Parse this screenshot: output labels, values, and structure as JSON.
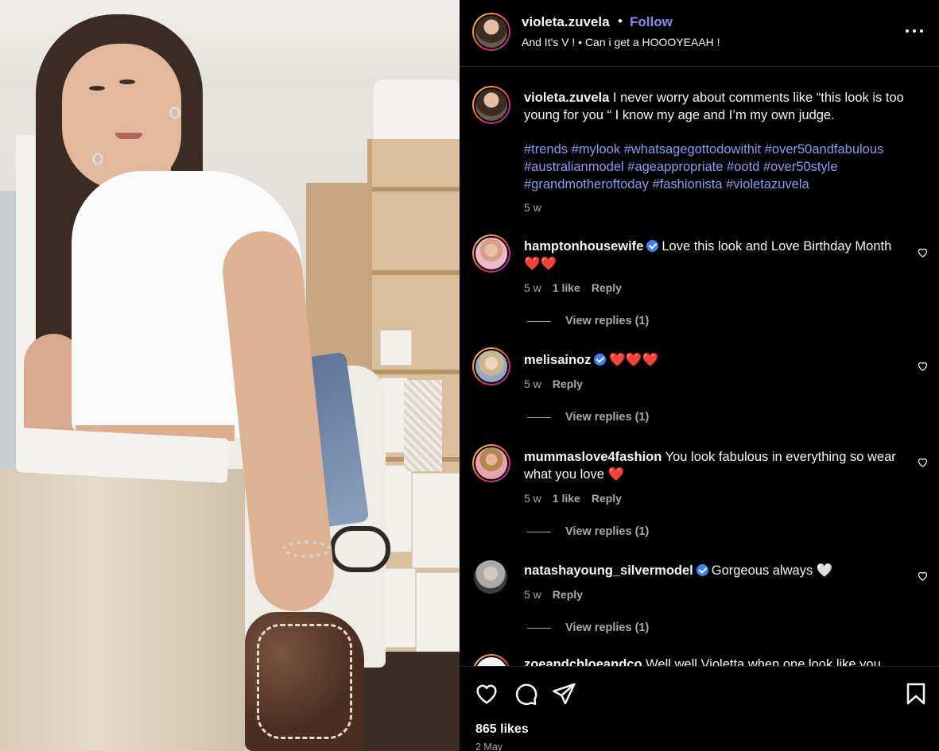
{
  "post": {
    "username": "violeta.zuvela",
    "follow_label": "Follow",
    "subtitle": "And It's V ! • Can i get a HOOOYEAAH !",
    "caption_username": "violeta.zuvela",
    "caption_text": "I never worry about comments like “this look is too young for you “ I know my age and I’m my own judge.",
    "hashtags": [
      "#trends",
      "#mylook",
      "#whatsagegottodowithit",
      "#over50andfabulous",
      "#australianmodel",
      "#ageappropriate",
      "#ootd",
      "#over50style",
      "#grandmotheroftoday",
      "#fashionista",
      "#violetazuvela"
    ],
    "caption_time": "5 w"
  },
  "comments": [
    {
      "username": "hamptonhousewife",
      "verified": true,
      "text": "Love this look and Love Birthday Month ❤️❤️",
      "time": "5 w",
      "likes": "1 like",
      "reply_label": "Reply",
      "view_replies": "View replies (1)"
    },
    {
      "username": "melisainoz",
      "verified": true,
      "text": "❤️❤️❤️",
      "time": "5 w",
      "likes": "",
      "reply_label": "Reply",
      "view_replies": "View replies (1)"
    },
    {
      "username": "mummaslove4fashion",
      "verified": false,
      "text": "You look fabulous in everything so wear what you love ❤️",
      "time": "5 w",
      "likes": "1 like",
      "reply_label": "Reply",
      "view_replies": "View replies (1)"
    },
    {
      "username": "natashayoung_silvermodel",
      "verified": true,
      "text": "Gorgeous always 🤍",
      "time": "5 w",
      "likes": "",
      "reply_label": "Reply",
      "view_replies": "View replies (1)"
    },
    {
      "username": "zoeandchloeandco",
      "verified": false,
      "text": "Well well Violetta when one look like you",
      "time": "",
      "likes": "",
      "reply_label": "",
      "view_replies": ""
    }
  ],
  "footer": {
    "likes": "865 likes",
    "date": "2 May"
  },
  "colors": {
    "link_blue": "#7f8ef7",
    "hashtag_blue": "#8a9bf5",
    "muted": "#a8a8a8",
    "background": "#000000",
    "verified": "#3b82f6"
  },
  "icons": [
    "more-options-icon",
    "heart-icon",
    "comment-icon",
    "share-icon",
    "bookmark-icon",
    "verified-badge-icon"
  ]
}
